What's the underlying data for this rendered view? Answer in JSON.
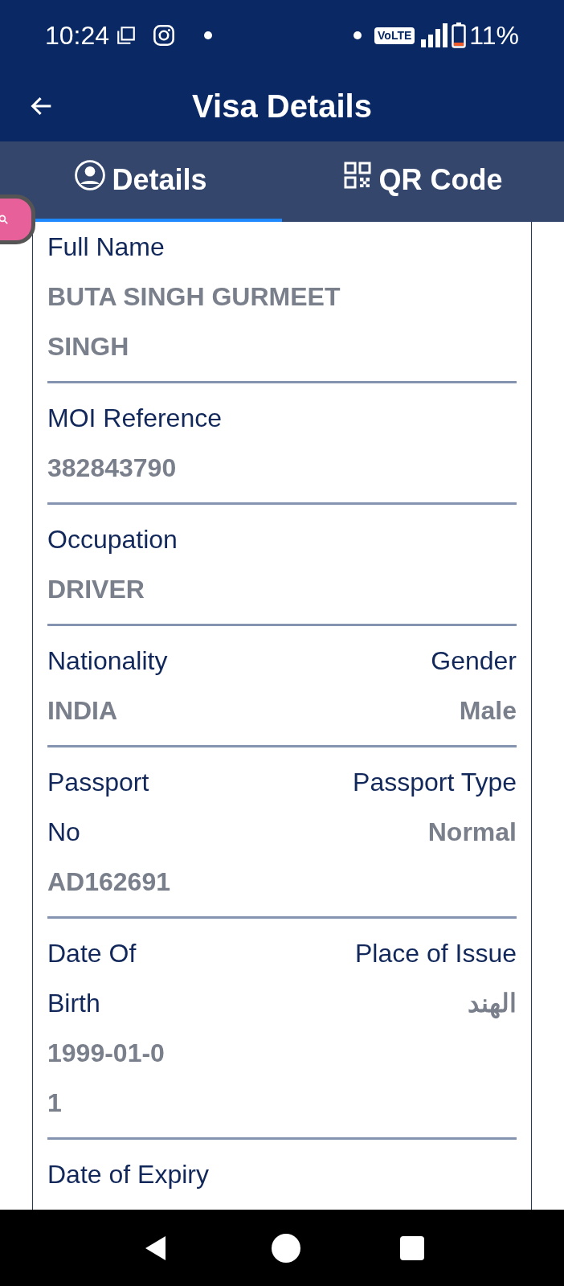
{
  "status_bar": {
    "time": "10:24",
    "battery": "11%",
    "network": "VoLTE"
  },
  "app_bar": {
    "title": "Visa Details"
  },
  "tabs": [
    {
      "label": "Details",
      "kind": "person",
      "selected": true
    },
    {
      "label": "QR Code",
      "kind": "qr",
      "selected": false
    }
  ],
  "rows": [
    {
      "left": {
        "label": "Full Name",
        "value": "BUTA SINGH GURMEET SINGH"
      }
    },
    {
      "left": {
        "label": "MOI Reference",
        "value": "382843790"
      }
    },
    {
      "left": {
        "label": "Occupation",
        "value": "DRIVER"
      }
    },
    {
      "left": {
        "label": "Nationality",
        "value": "INDIA"
      },
      "right": {
        "label": "Gender",
        "value": "Male"
      }
    },
    {
      "left": {
        "label": "Passport No",
        "value": "AD162691"
      },
      "right": {
        "label": "Passport Type",
        "value": "Normal"
      }
    },
    {
      "left": {
        "label": "Date Of Birth",
        "value": "1999-01-01"
      },
      "right": {
        "label": "Place of Issue",
        "value": "الهند"
      }
    },
    {
      "left": {
        "label": "Date of Expiry"
      }
    }
  ]
}
